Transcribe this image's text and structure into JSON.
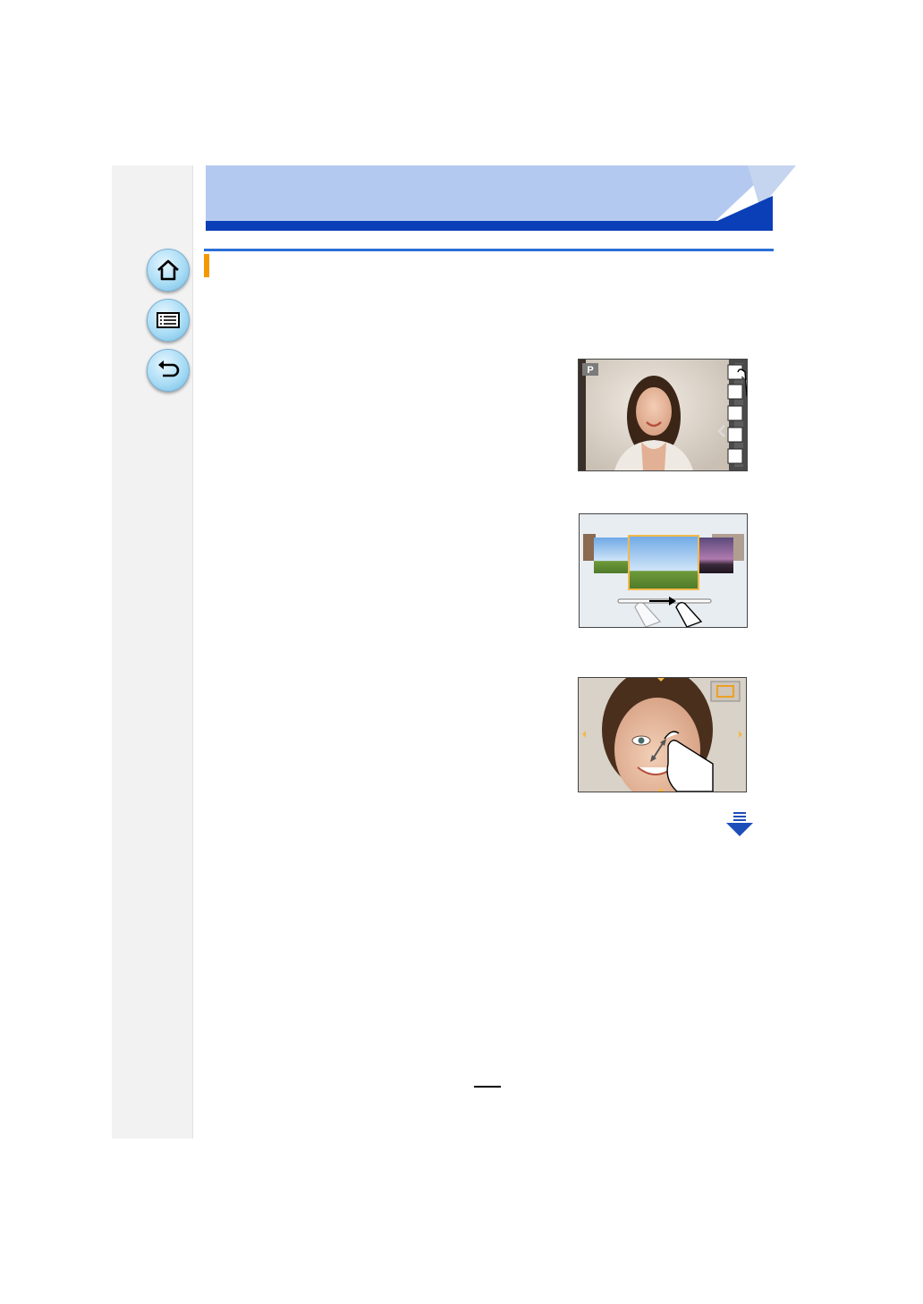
{
  "header": {
    "title": ""
  },
  "section": {
    "title": ""
  },
  "nav": {
    "home": {
      "icon": "home-icon"
    },
    "contents": {
      "icon": "list-icon"
    },
    "back": {
      "icon": "back-arrow-icon"
    }
  },
  "illustrations": {
    "shooting_screen": {
      "mode_label": "P"
    },
    "playback_screen": {},
    "zoom_screen": {}
  },
  "continued": {
    "icon": "continued-arrow-icon"
  },
  "footer": {
    "page_number": ""
  },
  "colors": {
    "header_light": "#b4c9ef",
    "header_dark": "#0a3fb8",
    "rule_blue": "#2b6fd6",
    "marker_orange": "#f39800",
    "sidebar_gray": "#f2f2f2",
    "nav_button_blue": "#a9dcf5"
  }
}
